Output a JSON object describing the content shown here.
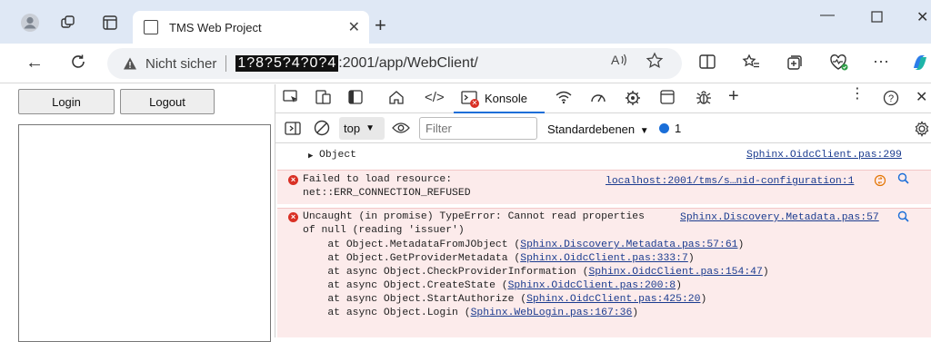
{
  "browser": {
    "tab_title": "TMS Web Project",
    "security_label": "Nicht sicher",
    "url_host": "1?8?5?4?0?4",
    "url_path": ":2001/app/WebClient/"
  },
  "page": {
    "login_label": "Login",
    "logout_label": "Logout"
  },
  "devtools": {
    "active_tab": "Konsole",
    "context": "top",
    "filter_placeholder": "Filter",
    "levels_label": "Standardebenen",
    "issues_count": "1"
  },
  "console": {
    "object_entry": {
      "text": "Object",
      "source": "Sphinx.OidcClient.pas:299"
    },
    "error1": {
      "line1": "Failed to load resource:",
      "line2": "net::ERR_CONNECTION_REFUSED",
      "source": "localhost:2001/tms/s…nid-configuration:1"
    },
    "error2": {
      "line1": "Uncaught (in promise) TypeError: Cannot read properties",
      "line2": "of null (reading 'issuer')",
      "source": "Sphinx.Discovery.Metadata.pas:57",
      "stack": [
        {
          "prefix": "    at Object.MetadataFromJObject (",
          "link": "Sphinx.Discovery.Metadata.pas:57:61",
          "suffix": ")"
        },
        {
          "prefix": "    at Object.GetProviderMetadata (",
          "link": "Sphinx.OidcClient.pas:333:7",
          "suffix": ")"
        },
        {
          "prefix": "    at async Object.CheckProviderInformation (",
          "link": "Sphinx.OidcClient.pas:154:47",
          "suffix": ")"
        },
        {
          "prefix": "    at async Object.CreateState (",
          "link": "Sphinx.OidcClient.pas:200:8",
          "suffix": ")"
        },
        {
          "prefix": "    at async Object.StartAuthorize (",
          "link": "Sphinx.OidcClient.pas:425:20",
          "suffix": ")"
        },
        {
          "prefix": "    at async Object.Login (",
          "link": "Sphinx.WebLogin.pas:167:36",
          "suffix": ")"
        }
      ]
    }
  }
}
